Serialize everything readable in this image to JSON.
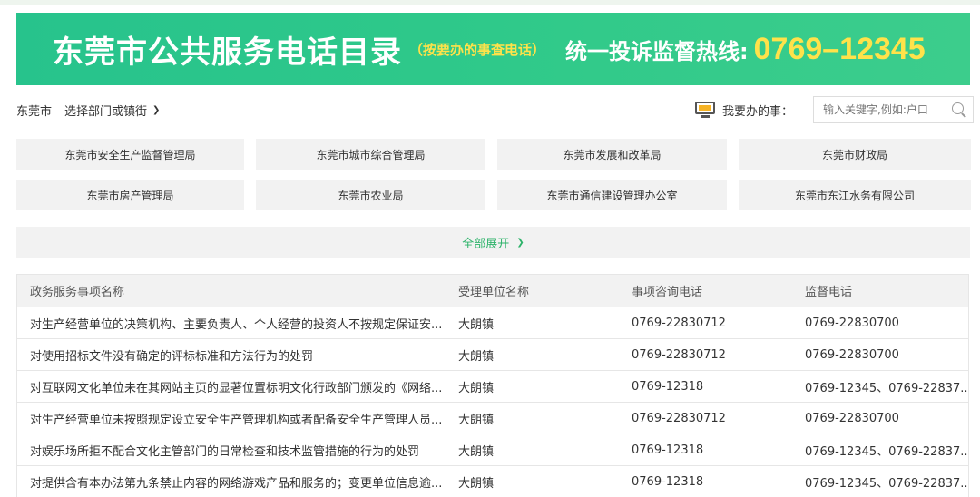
{
  "banner": {
    "title": "东莞市公共服务电话目录",
    "subtitle": "（按要办的事查电话）",
    "hotline_label": "统一投诉监督热线:",
    "hotline_number": "0769–12345"
  },
  "location": {
    "city": "东莞市",
    "dept_select": "选择部门或镇街",
    "chevron": "chevron-down-icon"
  },
  "search": {
    "label": "我要办的事：",
    "placeholder": "输入关键字,例如:户口"
  },
  "departments": [
    "东莞市安全生产监督管理局",
    "东莞市城市综合管理局",
    "东莞市发展和改革局",
    "东莞市财政局",
    "东莞市房产管理局",
    "东莞市农业局",
    "东莞市通信建设管理办公室",
    "东莞市东江水务有限公司"
  ],
  "expand_label": "全部展开",
  "table": {
    "headers": [
      "政务服务事项名称",
      "受理单位名称",
      "事项咨询电话",
      "监督电话"
    ],
    "rows": [
      [
        "对生产经营单位的决策机构、主要负责人、个人经营的投资人不按规定保证安...",
        "大朗镇",
        "0769-22830712",
        "0769-22830700"
      ],
      [
        "对使用招标文件没有确定的评标标准和方法行为的处罚",
        "大朗镇",
        "0769-22830712",
        "0769-22830700"
      ],
      [
        "对互联网文化单位未在其网站主页的显著位置标明文化行政部门颁发的《网络...",
        "大朗镇",
        "0769-12318",
        "0769-12345、0769-22837..."
      ],
      [
        "对生产经营单位未按照规定设立安全生产管理机构或者配备安全生产管理人员...",
        "大朗镇",
        "0769-22830712",
        "0769-22830700"
      ],
      [
        "对娱乐场所拒不配合文化主管部门的日常检查和技术监管措施的行为的处罚",
        "大朗镇",
        "0769-12318",
        "0769-12345、0769-22837..."
      ],
      [
        "对提供含有本办法第九条禁止内容的网络游戏产品和服务的；变更单位信息逾...",
        "大朗镇",
        "0769-12318",
        "0769-12345、0769-22837..."
      ]
    ]
  },
  "colors": {
    "banner_green": "#2fc98a",
    "accent_yellow": "#ffe24a",
    "link_green": "#2db36a"
  }
}
